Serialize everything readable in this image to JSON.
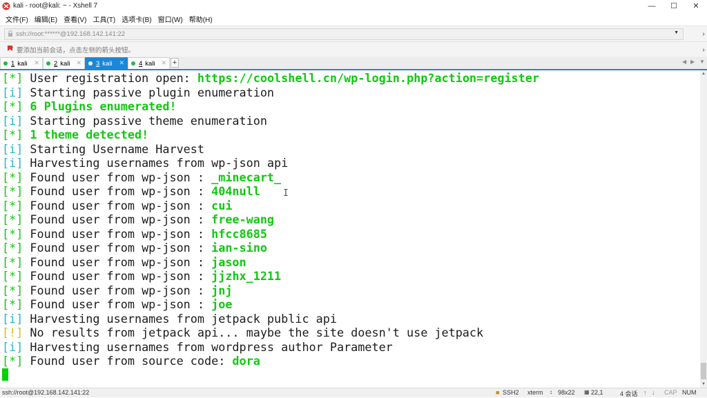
{
  "window": {
    "title": "kali - root@kali: ~ - Xshell 7"
  },
  "menu": [
    "文件(F)",
    "编辑(E)",
    "查看(V)",
    "工具(T)",
    "选项卡(B)",
    "窗口(W)",
    "帮助(H)"
  ],
  "address": {
    "value": "ssh://root:******@192.168.142.141:22"
  },
  "hint": "要添加当前会话，点击左侧的箭头按钮。",
  "tabs": [
    {
      "num": "1",
      "name": "kali",
      "active": false
    },
    {
      "num": "2",
      "name": "kali",
      "active": false
    },
    {
      "num": "3",
      "name": "kali",
      "active": true
    },
    {
      "num": "4",
      "name": "kali",
      "active": false
    }
  ],
  "terminal": {
    "lines": [
      {
        "tag": "[*]",
        "text": " User registration open: ",
        "hl": "https://coolshell.cn/wp-login.php?action=register"
      },
      {
        "tag": "[i]",
        "text": " Starting passive plugin enumeration",
        "hl": ""
      },
      {
        "tag": "[*]",
        "text": "",
        "hl": " 6 Plugins enumerated!"
      },
      {
        "tag": "[i]",
        "text": " Starting passive theme enumeration",
        "hl": ""
      },
      {
        "tag": "[*]",
        "text": "",
        "hl": " 1 theme detected!"
      },
      {
        "tag": "[i]",
        "text": " Starting Username Harvest",
        "hl": ""
      },
      {
        "tag": "[i]",
        "text": " Harvesting usernames from wp-json api",
        "hl": ""
      },
      {
        "tag": "[*]",
        "text": " Found user from wp-json : ",
        "hl": "_minecart_"
      },
      {
        "tag": "[*]",
        "text": " Found user from wp-json : ",
        "hl": "404null"
      },
      {
        "tag": "[*]",
        "text": " Found user from wp-json : ",
        "hl": "cui"
      },
      {
        "tag": "[*]",
        "text": " Found user from wp-json : ",
        "hl": "free-wang"
      },
      {
        "tag": "[*]",
        "text": " Found user from wp-json : ",
        "hl": "hfcc8685"
      },
      {
        "tag": "[*]",
        "text": " Found user from wp-json : ",
        "hl": "ian-sino"
      },
      {
        "tag": "[*]",
        "text": " Found user from wp-json : ",
        "hl": "jason"
      },
      {
        "tag": "[*]",
        "text": " Found user from wp-json : ",
        "hl": "jjzhx_1211"
      },
      {
        "tag": "[*]",
        "text": " Found user from wp-json : ",
        "hl": "jnj"
      },
      {
        "tag": "[*]",
        "text": " Found user from wp-json : ",
        "hl": "joe"
      },
      {
        "tag": "[i]",
        "text": " Harvesting usernames from jetpack public api",
        "hl": ""
      },
      {
        "tag": "[!]",
        "text": " No results from jetpack api... maybe the site doesn't use jetpack",
        "hl": ""
      },
      {
        "tag": "[i]",
        "text": " Harvesting usernames from wordpress author Parameter",
        "hl": ""
      },
      {
        "tag": "[*]",
        "text": " Found user from source code: ",
        "hl": "dora"
      }
    ]
  },
  "status": {
    "connection": "ssh://root@192.168.142.141:22",
    "protocol": "SSH2",
    "term": "xterm",
    "size": "98x22",
    "pos": "22,1",
    "sessions": "4 会话",
    "cap": "CAP",
    "num": "NUM"
  },
  "colors": {
    "green": "#11c811",
    "cyan": "#27b4c4",
    "yellow": "#c9c218",
    "tab_active": "#1a87d8",
    "cursor": "#00d200"
  },
  "icons": {
    "app": "xshell-logo-icon",
    "close": "close-icon",
    "maximize": "maximize-icon",
    "minimize": "minimize-icon",
    "add_session": "bookmark-arrow-icon",
    "lock": "lock-icon"
  }
}
